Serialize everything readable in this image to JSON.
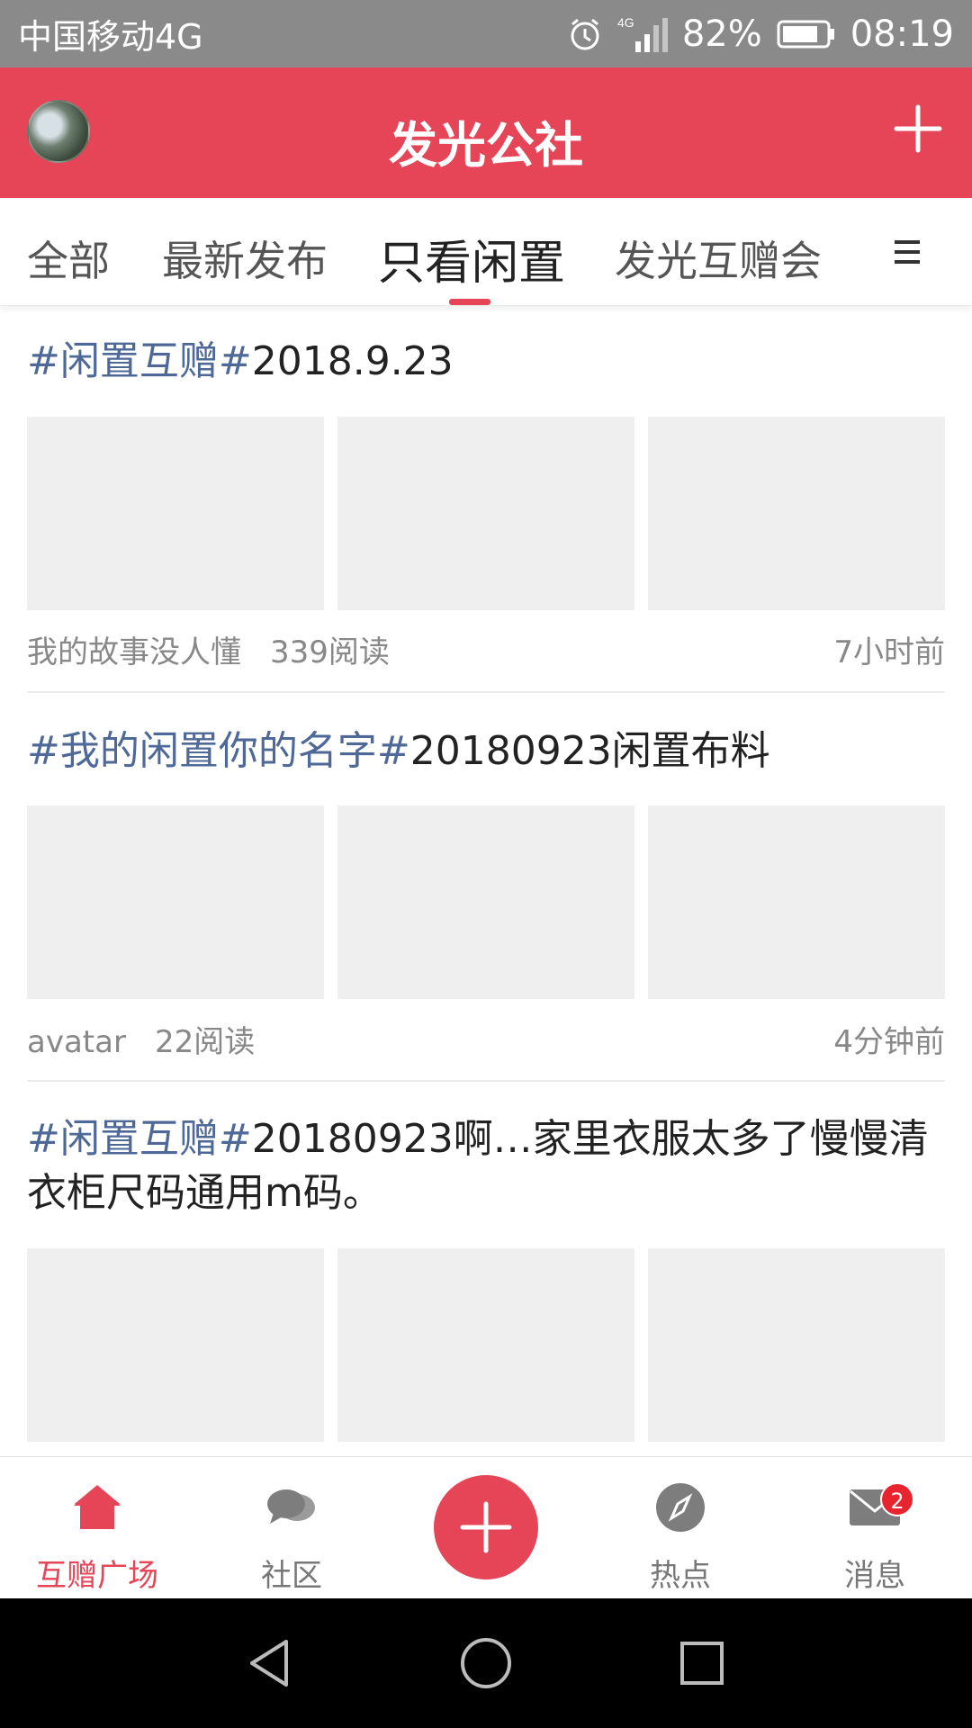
{
  "status_bar": {
    "carrier": "中国移动4G",
    "battery": "82%",
    "time": "08:19"
  },
  "app_bar": {
    "title": "发光公社"
  },
  "tabs": [
    {
      "label": "全部",
      "active": false
    },
    {
      "label": "最新发布",
      "active": false
    },
    {
      "label": "只看闲置",
      "active": true
    },
    {
      "label": "发光互赠会",
      "active": false
    }
  ],
  "posts": [
    {
      "tag": "#闲置互赠#",
      "text": "2018.9.23",
      "author": "我的故事没人懂",
      "reads": "339阅读",
      "time": "7小时前"
    },
    {
      "tag": "#我的闲置你的名字#",
      "text": "20180923闲置布料",
      "author": "avatar",
      "reads": "22阅读",
      "time": "4分钟前"
    },
    {
      "tag": "#闲置互赠#",
      "text": "20180923啊…家里衣服太多了慢慢清衣柜尺码通用m码。"
    }
  ],
  "bottom_nav": {
    "items": [
      {
        "label": "互赠广场",
        "icon": "home-icon",
        "active": true
      },
      {
        "label": "社区",
        "icon": "chat-bubbles-icon",
        "active": false
      },
      {
        "label": "热点",
        "icon": "compass-icon",
        "active": false
      },
      {
        "label": "消息",
        "icon": "mail-icon",
        "active": false
      }
    ],
    "message_badge": "2"
  },
  "colors": {
    "brand": "#e64457",
    "tag_blue": "#4e6897",
    "placeholder": "#efefef"
  }
}
